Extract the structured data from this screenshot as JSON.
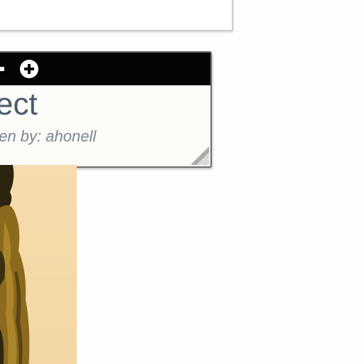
{
  "top_panel": {},
  "card": {
    "title": "sect",
    "subtitle": "tten by: ahonell",
    "icons": [
      "collapse-icon",
      "add-icon",
      "resize-handle-icon"
    ],
    "colors": {
      "header": "#050505",
      "title": "#4a5a6e",
      "subtitle": "#7a8696",
      "border": "#6d6d6d"
    }
  },
  "photo": {
    "subject": "person-in-robe-image",
    "colors": {
      "background": "#f5d9a8",
      "robe": "#8b6a1e",
      "shadow": "#2c2510"
    }
  }
}
